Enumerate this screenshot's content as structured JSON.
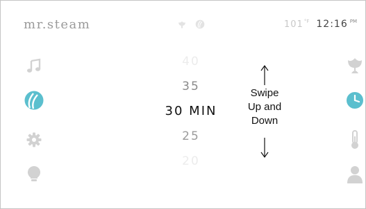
{
  "header": {
    "brand": "mr.steam",
    "mode_icons": [
      "aromatherapy-icon",
      "steam-leaf-icon"
    ],
    "temperature": "101",
    "temperature_unit": "°F",
    "time": "12:16",
    "time_suffix": "PM"
  },
  "left_nav": [
    {
      "name": "music-icon",
      "active": false
    },
    {
      "name": "steam-icon",
      "active": true
    },
    {
      "name": "settings-icon",
      "active": false
    },
    {
      "name": "light-icon",
      "active": false
    }
  ],
  "right_nav": [
    {
      "name": "aromatherapy-icon",
      "active": false
    },
    {
      "name": "timer-icon",
      "active": true
    },
    {
      "name": "thermometer-icon",
      "active": false
    },
    {
      "name": "user-icon",
      "active": false
    }
  ],
  "picker": {
    "values": [
      "40",
      "35",
      "30 MIN",
      "25",
      "20"
    ],
    "selected_index": 2
  },
  "hint": {
    "lines": [
      "Swipe",
      "Up and",
      "Down"
    ]
  },
  "colors": {
    "accent": "#5bbfce",
    "inactive_icon": "#d2d2d2",
    "header_icon": "#e3e3e3"
  }
}
